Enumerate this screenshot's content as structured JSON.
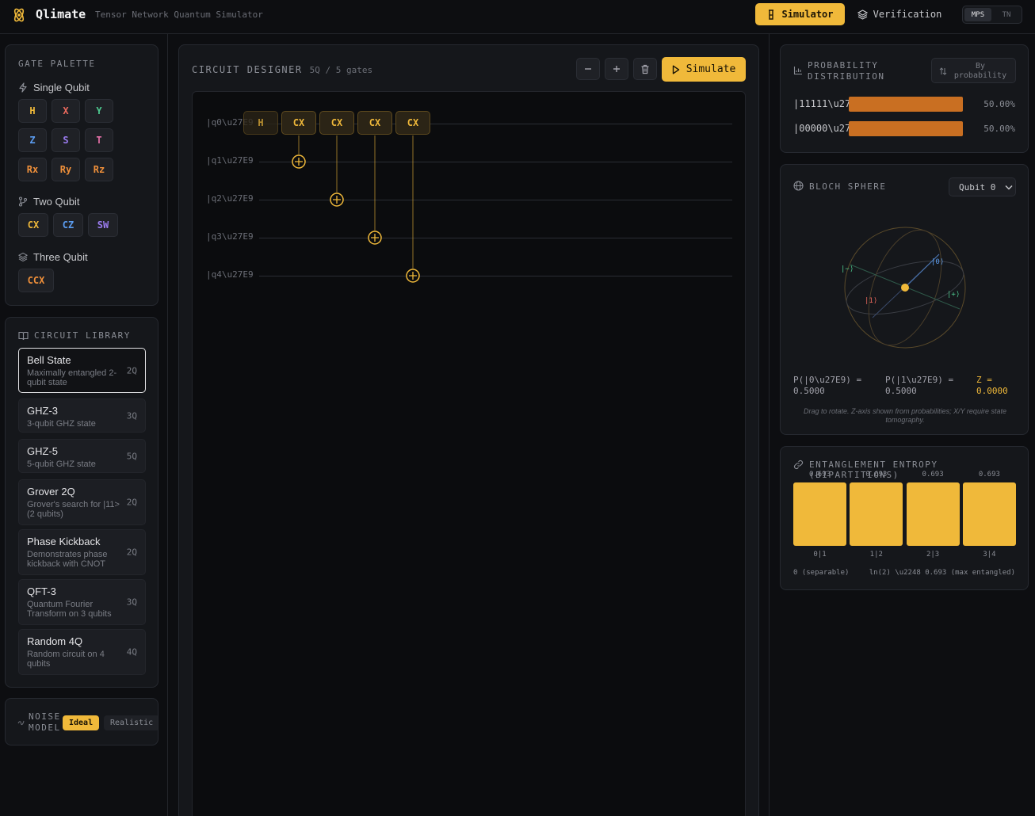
{
  "header": {
    "title": "Qlimate",
    "subtitle": "Tensor Network Quantum Simulator",
    "nav_simulator": "Simulator",
    "nav_verification": "Verification",
    "backend_options": [
      "MPS",
      "TN"
    ],
    "backend_selected": "MPS"
  },
  "palette": {
    "title": "GATE PALETTE",
    "single_label": "Single Qubit",
    "two_label": "Two Qubit",
    "three_label": "Three Qubit",
    "single_gates": [
      {
        "label": "H",
        "color": "#f0b93a"
      },
      {
        "label": "X",
        "color": "#ef6b5f"
      },
      {
        "label": "Y",
        "color": "#4ec98f"
      },
      {
        "label": "Z",
        "color": "#5b9cf0"
      },
      {
        "label": "S",
        "color": "#9b7cf0"
      },
      {
        "label": "T",
        "color": "#e26fa6"
      },
      {
        "label": "Rx",
        "color": "#f0903a"
      },
      {
        "label": "Ry",
        "color": "#f0903a"
      },
      {
        "label": "Rz",
        "color": "#f0903a"
      }
    ],
    "two_gates": [
      {
        "label": "CX",
        "color": "#f0b93a"
      },
      {
        "label": "CZ",
        "color": "#5b9cf0"
      },
      {
        "label": "SW",
        "color": "#9b7cf0"
      }
    ],
    "three_gates": [
      {
        "label": "CCX",
        "color": "#f0903a"
      }
    ]
  },
  "library": {
    "title": "CIRCUIT LIBRARY",
    "items": [
      {
        "name": "Bell State",
        "desc": "Maximally entangled 2-qubit state",
        "qubits": "2Q"
      },
      {
        "name": "GHZ-3",
        "desc": "3-qubit GHZ state",
        "qubits": "3Q"
      },
      {
        "name": "GHZ-5",
        "desc": "5-qubit GHZ state",
        "qubits": "5Q"
      },
      {
        "name": "Grover 2Q",
        "desc": "Grover's search for |11> (2 qubits)",
        "qubits": "2Q"
      },
      {
        "name": "Phase Kickback",
        "desc": "Demonstrates phase kickback with CNOT",
        "qubits": "2Q"
      },
      {
        "name": "QFT-3",
        "desc": "Quantum Fourier Transform on 3 qubits",
        "qubits": "3Q"
      },
      {
        "name": "Random 4Q",
        "desc": "Random circuit on 4 qubits",
        "qubits": "4Q"
      }
    ]
  },
  "noise": {
    "title_line1": "NOISE",
    "title_line2": "MODEL",
    "options": [
      "Ideal",
      "Realistic"
    ],
    "selected": "Ideal"
  },
  "designer": {
    "title": "CIRCUIT DESIGNER",
    "info": "5Q / 5 gates",
    "simulate_label": "Simulate",
    "qubit_labels": [
      "|q0\\u27E9",
      "|q1\\u27E9",
      "|q2\\u27E9",
      "|q3\\u27E9",
      "|q4\\u27E9"
    ],
    "gates": [
      "H",
      "CX",
      "CX",
      "CX",
      "CX"
    ]
  },
  "probability": {
    "title_line1": "PROBABILITY",
    "title_line2": "DISTRIBUTION",
    "sort_line1": "By",
    "sort_line2": "probability",
    "rows": [
      {
        "state": "|11111\\u27E9",
        "value": 0.5,
        "label": "50.00%"
      },
      {
        "state": "|00000\\u27E9",
        "value": 0.5,
        "label": "50.00%"
      }
    ]
  },
  "bloch": {
    "title": "BLOCH SPHERE",
    "qubit_select": "Qubit 0",
    "axis_labels": {
      "zero": "|0⟩",
      "one": "|1⟩",
      "plus": "|+⟩",
      "minus": "|−⟩"
    },
    "p0_label": "P(|0\\u27E9) =",
    "p0_value": "0.5000",
    "p1_label": "P(|1\\u27E9) =",
    "p1_value": "0.5000",
    "z_label": "Z =",
    "z_value": "0.0000",
    "note": "Drag to rotate. Z-axis shown from probabilities; X/Y require state tomography."
  },
  "entropy": {
    "title": "ENTANGLEMENT ENTROPY (BIPARTITIONS)",
    "bars": [
      {
        "label": "0|1",
        "value": "0.693"
      },
      {
        "label": "1|2",
        "value": "0.693"
      },
      {
        "label": "2|3",
        "value": "0.693"
      },
      {
        "label": "3|4",
        "value": "0.693"
      }
    ],
    "legend_left": "0 (separable)",
    "legend_right": "ln(2) \\u2248 0.693 (max entangled)"
  }
}
